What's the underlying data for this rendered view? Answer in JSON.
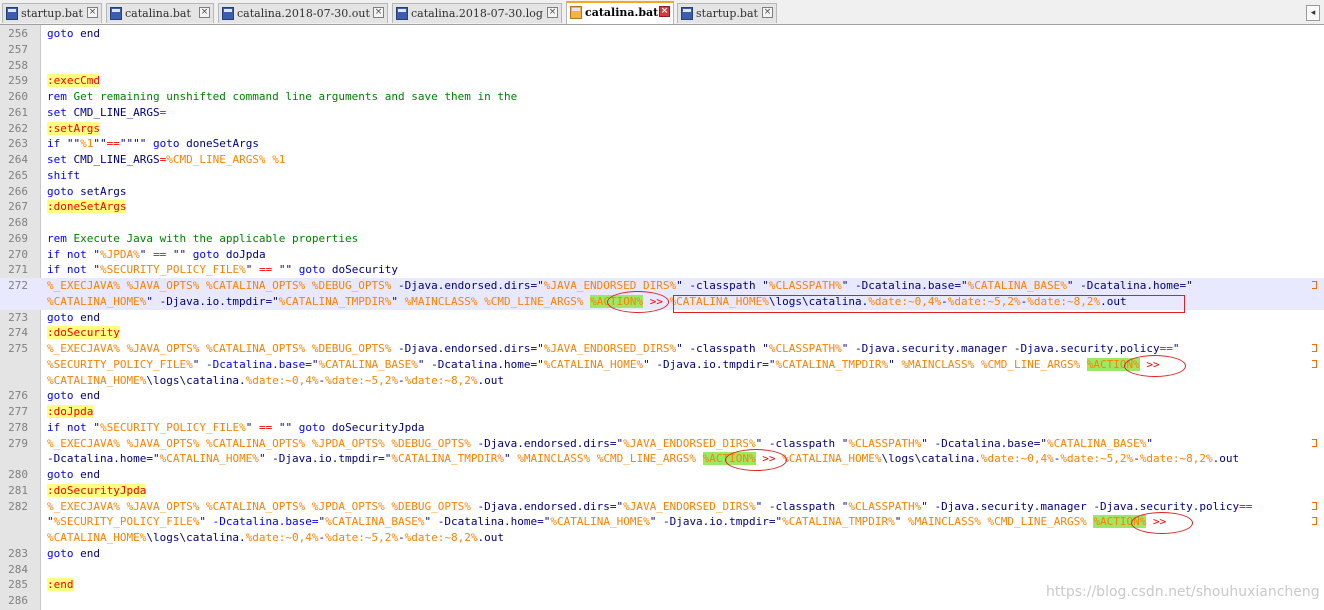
{
  "tabs": [
    {
      "label": "startup.bat",
      "active": false
    },
    {
      "label": "catalina.bat",
      "active": false
    },
    {
      "label": "catalina.2018-07-30.out",
      "active": false
    },
    {
      "label": "catalina.2018-07-30.log",
      "active": false
    },
    {
      "label": "catalina.bat",
      "active": true
    },
    {
      "label": "startup.bat",
      "active": false
    }
  ],
  "tab_close_glyph": "×",
  "scroll_left_glyph": "◂",
  "colors": {
    "keyword": "#0000ff",
    "comment": "#008000",
    "variable": "#ff8000",
    "label_bg": "#ffff80",
    "action_bg": "#9be865",
    "annotation": "#e02020"
  },
  "icons": {
    "file": "file-icon",
    "close": "close-icon",
    "wrap": "wrap-arrow-icon"
  },
  "current_line": "272",
  "lines": [
    {
      "n": "256",
      "segs": [
        [
          "kw",
          "goto"
        ],
        [
          "t",
          " end"
        ]
      ]
    },
    {
      "n": "257",
      "segs": []
    },
    {
      "n": "258",
      "segs": []
    },
    {
      "n": "259",
      "segs": [
        [
          "lbl",
          ":execCmd"
        ]
      ]
    },
    {
      "n": "260",
      "segs": [
        [
          "kw",
          "rem"
        ],
        [
          "cm",
          " Get remaining unshifted command line arguments and save them in the"
        ]
      ]
    },
    {
      "n": "261",
      "segs": [
        [
          "kw",
          "set"
        ],
        [
          "t",
          " CMD_LINE_ARGS"
        ],
        [
          "op",
          "="
        ]
      ]
    },
    {
      "n": "262",
      "segs": [
        [
          "lbl",
          ":setArgs"
        ]
      ]
    },
    {
      "n": "263",
      "segs": [
        [
          "kw",
          "if"
        ],
        [
          "t",
          " \"\""
        ],
        [
          "var",
          "%1"
        ],
        [
          "t",
          "\"\""
        ],
        [
          "op",
          "=="
        ],
        [
          "t",
          "\"\"\"\" "
        ],
        [
          "kw",
          "goto"
        ],
        [
          "t",
          " doneSetArgs"
        ]
      ]
    },
    {
      "n": "264",
      "segs": [
        [
          "kw",
          "set"
        ],
        [
          "t",
          " CMD_LINE_ARGS"
        ],
        [
          "op",
          "="
        ],
        [
          "var",
          "%CMD_LINE_ARGS%"
        ],
        [
          "t",
          " "
        ],
        [
          "var",
          "%1"
        ]
      ]
    },
    {
      "n": "265",
      "segs": [
        [
          "kw",
          "shift"
        ]
      ]
    },
    {
      "n": "266",
      "segs": [
        [
          "kw",
          "goto"
        ],
        [
          "t",
          " setArgs"
        ]
      ]
    },
    {
      "n": "267",
      "segs": [
        [
          "lbl",
          ":doneSetArgs"
        ]
      ]
    },
    {
      "n": "268",
      "segs": []
    },
    {
      "n": "269",
      "segs": [
        [
          "kw",
          "rem"
        ],
        [
          "cm",
          " Execute Java with the applicable properties"
        ]
      ]
    },
    {
      "n": "270",
      "segs": [
        [
          "kw",
          "if not"
        ],
        [
          "t",
          " \""
        ],
        [
          "var",
          "%JPDA%"
        ],
        [
          "t",
          "\" "
        ],
        [
          "op",
          "=="
        ],
        [
          "t",
          " \"\" "
        ],
        [
          "kw",
          "goto"
        ],
        [
          "t",
          " doJpda"
        ]
      ]
    },
    {
      "n": "271",
      "segs": [
        [
          "kw",
          "if not"
        ],
        [
          "t",
          " \""
        ],
        [
          "var",
          "%SECURITY_POLICY_FILE%"
        ],
        [
          "t",
          "\" "
        ],
        [
          "op",
          "=="
        ],
        [
          "t",
          " \"\" "
        ],
        [
          "kw",
          "goto"
        ],
        [
          "t",
          " doSecurity"
        ]
      ]
    },
    {
      "n": "272",
      "segs": [
        [
          "var",
          "%_EXECJAVA% %JAVA_OPTS% %CATALINA_OPTS% %DEBUG_OPTS%"
        ],
        [
          "t",
          " -Djava.endorsed.dirs=\""
        ],
        [
          "var",
          "%JAVA_ENDORSED_DIRS%"
        ],
        [
          "t",
          "\" -classpath \""
        ],
        [
          "var",
          "%CLASSPATH%"
        ],
        [
          "t",
          "\" -Dcatalina.base=\""
        ],
        [
          "var",
          "%CATALINA_BASE%"
        ],
        [
          "t",
          "\" -Dcatalina.home=\""
        ]
      ],
      "wrap": true
    },
    {
      "n": "",
      "cont": true,
      "segs": [
        [
          "var",
          "%CATALINA_HOME%"
        ],
        [
          "t",
          "\" -Djava.io.tmpdir=\""
        ],
        [
          "var",
          "%CATALINA_TMPDIR%"
        ],
        [
          "t",
          "\" "
        ],
        [
          "var",
          "%MAINCLASS% %CMD_LINE_ARGS% "
        ],
        [
          "act",
          "%ACTION%"
        ],
        [
          "t",
          " "
        ],
        [
          "redir",
          ">>"
        ],
        [
          "t",
          " "
        ],
        [
          "var",
          "%CATALINA_HOME%"
        ],
        [
          "t",
          "\\logs\\catalina."
        ],
        [
          "var",
          "%date:~0,4%"
        ],
        [
          "t",
          "-"
        ],
        [
          "var",
          "%date:~5,2%"
        ],
        [
          "t",
          "-"
        ],
        [
          "var",
          "%date:~8,2%"
        ],
        [
          "t",
          ".out"
        ]
      ]
    },
    {
      "n": "273",
      "segs": [
        [
          "kw",
          "goto"
        ],
        [
          "t",
          " end"
        ]
      ]
    },
    {
      "n": "274",
      "segs": [
        [
          "lbl",
          ":doSecurity"
        ]
      ]
    },
    {
      "n": "275",
      "segs": [
        [
          "var",
          "%_EXECJAVA% %JAVA_OPTS% %CATALINA_OPTS% %DEBUG_OPTS%"
        ],
        [
          "t",
          " -Djava.endorsed.dirs=\""
        ],
        [
          "var",
          "%JAVA_ENDORSED_DIRS%"
        ],
        [
          "t",
          "\" -classpath \""
        ],
        [
          "var",
          "%CLASSPATH%"
        ],
        [
          "t",
          "\" -Djava.security.manager -Djava.security.policy"
        ],
        [
          "op",
          "=="
        ],
        [
          "t",
          "\""
        ]
      ],
      "wrap": true
    },
    {
      "n": "",
      "cont": true,
      "segs": [
        [
          "var",
          "%SECURITY_POLICY_FILE%"
        ],
        [
          "t",
          "\" "
        ],
        [
          "kw",
          "-Dcatalina.base="
        ],
        [
          "t",
          "\""
        ],
        [
          "var",
          "%CATALINA_BASE%"
        ],
        [
          "t",
          "\" -Dcatalina.home=\""
        ],
        [
          "var",
          "%CATALINA_HOME%"
        ],
        [
          "t",
          "\" -Djava.io.tmpdir=\""
        ],
        [
          "var",
          "%CATALINA_TMPDIR%"
        ],
        [
          "t",
          "\" "
        ],
        [
          "var",
          "%MAINCLASS% %CMD_LINE_ARGS% "
        ],
        [
          "act",
          "%ACTION%"
        ],
        [
          "t",
          " "
        ],
        [
          "redir",
          ">>"
        ]
      ],
      "wrap": true
    },
    {
      "n": "",
      "cont": true,
      "segs": [
        [
          "var",
          "%CATALINA_HOME%"
        ],
        [
          "t",
          "\\logs\\catalina."
        ],
        [
          "var",
          "%date:~0,4%"
        ],
        [
          "t",
          "-"
        ],
        [
          "var",
          "%date:~5,2%"
        ],
        [
          "t",
          "-"
        ],
        [
          "var",
          "%date:~8,2%"
        ],
        [
          "t",
          ".out"
        ]
      ]
    },
    {
      "n": "276",
      "segs": [
        [
          "kw",
          "goto"
        ],
        [
          "t",
          " end"
        ]
      ]
    },
    {
      "n": "277",
      "segs": [
        [
          "lbl",
          ":doJpda"
        ]
      ]
    },
    {
      "n": "278",
      "segs": [
        [
          "kw",
          "if not"
        ],
        [
          "t",
          " \""
        ],
        [
          "var",
          "%SECURITY_POLICY_FILE%"
        ],
        [
          "t",
          "\" "
        ],
        [
          "op",
          "=="
        ],
        [
          "t",
          " \"\" "
        ],
        [
          "kw",
          "goto"
        ],
        [
          "t",
          " doSecurityJpda"
        ]
      ]
    },
    {
      "n": "279",
      "segs": [
        [
          "var",
          "%_EXECJAVA% %JAVA_OPTS% %CATALINA_OPTS% %JPDA_OPTS% %DEBUG_OPTS%"
        ],
        [
          "t",
          " -Djava.endorsed.dirs=\""
        ],
        [
          "var",
          "%JAVA_ENDORSED_DIRS%"
        ],
        [
          "t",
          "\" -classpath \""
        ],
        [
          "var",
          "%CLASSPATH%"
        ],
        [
          "t",
          "\" -Dcatalina.base=\""
        ],
        [
          "var",
          "%CATALINA_BASE%"
        ],
        [
          "t",
          "\""
        ]
      ],
      "wrap": true
    },
    {
      "n": "",
      "cont": true,
      "segs": [
        [
          "t",
          "-Dcatalina.home=\""
        ],
        [
          "var",
          "%CATALINA_HOME%"
        ],
        [
          "t",
          "\" -Djava.io.tmpdir=\""
        ],
        [
          "var",
          "%CATALINA_TMPDIR%"
        ],
        [
          "t",
          "\" "
        ],
        [
          "var",
          "%MAINCLASS% %CMD_LINE_ARGS% "
        ],
        [
          "act",
          "%ACTION%"
        ],
        [
          "t",
          " "
        ],
        [
          "redir",
          ">>"
        ],
        [
          "t",
          " "
        ],
        [
          "var",
          "%CATALINA_HOME%"
        ],
        [
          "t",
          "\\logs\\catalina."
        ],
        [
          "var",
          "%date:~0,4%"
        ],
        [
          "t",
          "-"
        ],
        [
          "var",
          "%date:~5,2%"
        ],
        [
          "t",
          "-"
        ],
        [
          "var",
          "%date:~8,2%"
        ],
        [
          "t",
          ".out"
        ]
      ]
    },
    {
      "n": "280",
      "segs": [
        [
          "kw",
          "goto"
        ],
        [
          "t",
          " end"
        ]
      ]
    },
    {
      "n": "281",
      "segs": [
        [
          "lbl",
          ":doSecurityJpda"
        ]
      ]
    },
    {
      "n": "282",
      "segs": [
        [
          "var",
          "%_EXECJAVA% %JAVA_OPTS% %CATALINA_OPTS% %JPDA_OPTS% %DEBUG_OPTS%"
        ],
        [
          "t",
          " -Djava.endorsed.dirs=\""
        ],
        [
          "var",
          "%JAVA_ENDORSED_DIRS%"
        ],
        [
          "t",
          "\" -classpath \""
        ],
        [
          "var",
          "%CLASSPATH%"
        ],
        [
          "t",
          "\" -Djava.security.manager -Djava.security.policy"
        ],
        [
          "op",
          "=="
        ]
      ],
      "wrap": true
    },
    {
      "n": "",
      "cont": true,
      "segs": [
        [
          "t",
          "\""
        ],
        [
          "var",
          "%SECURITY_POLICY_FILE%"
        ],
        [
          "t",
          "\" "
        ],
        [
          "kw",
          "-Dcatalina.base="
        ],
        [
          "t",
          "\""
        ],
        [
          "var",
          "%CATALINA_BASE%"
        ],
        [
          "t",
          "\" -Dcatalina.home=\""
        ],
        [
          "var",
          "%CATALINA_HOME%"
        ],
        [
          "t",
          "\" -Djava.io.tmpdir=\""
        ],
        [
          "var",
          "%CATALINA_TMPDIR%"
        ],
        [
          "t",
          "\" "
        ],
        [
          "var",
          "%MAINCLASS% %CMD_LINE_ARGS% "
        ],
        [
          "act",
          "%ACTION%"
        ],
        [
          "t",
          " "
        ],
        [
          "redir",
          ">>"
        ]
      ],
      "wrap": true
    },
    {
      "n": "",
      "cont": true,
      "segs": [
        [
          "var",
          "%CATALINA_HOME%"
        ],
        [
          "t",
          "\\logs\\catalina."
        ],
        [
          "var",
          "%date:~0,4%"
        ],
        [
          "t",
          "-"
        ],
        [
          "var",
          "%date:~5,2%"
        ],
        [
          "t",
          "-"
        ],
        [
          "var",
          "%date:~8,2%"
        ],
        [
          "t",
          ".out"
        ]
      ]
    },
    {
      "n": "283",
      "segs": [
        [
          "kw",
          "goto"
        ],
        [
          "t",
          " end"
        ]
      ]
    },
    {
      "n": "284",
      "segs": []
    },
    {
      "n": "285",
      "segs": [
        [
          "lbl",
          ":end"
        ]
      ]
    },
    {
      "n": "286",
      "segs": []
    }
  ],
  "watermark": "https://blog.csdn.net/shouhuxiancheng"
}
